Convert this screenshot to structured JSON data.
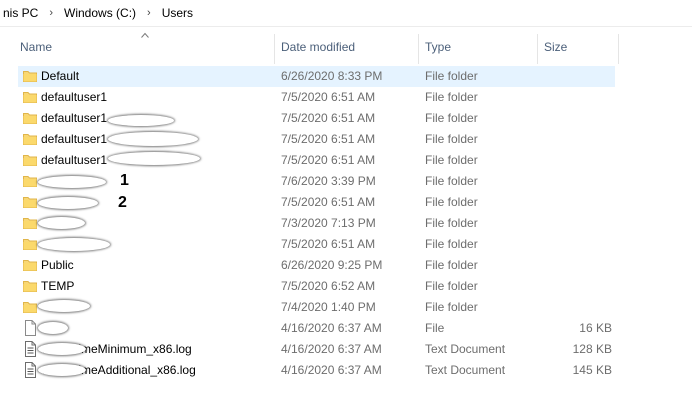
{
  "breadcrumb": [
    "nis PC",
    "Windows (C:)",
    "Users"
  ],
  "columns": {
    "name": "Name",
    "date": "Date modified",
    "type": "Type",
    "size": "Size"
  },
  "rows": [
    {
      "name": "Default",
      "date": "6/26/2020 8:33 PM",
      "type": "File folder",
      "size": "",
      "icon": "folder-icon"
    },
    {
      "name": "defaultuser1",
      "date": "7/5/2020 6:51 AM",
      "type": "File folder",
      "size": "",
      "icon": "folder-icon"
    },
    {
      "name": "defaultuser1",
      "date": "7/5/2020 6:51 AM",
      "type": "File folder",
      "size": "",
      "icon": "folder-icon"
    },
    {
      "name": "defaultuser1",
      "date": "7/5/2020 6:51 AM",
      "type": "File folder",
      "size": "",
      "icon": "folder-icon"
    },
    {
      "name": "defaultuser1",
      "date": "7/5/2020 6:51 AM",
      "type": "File folder",
      "size": "",
      "icon": "folder-icon"
    },
    {
      "name": "",
      "date": "7/6/2020 3:39 PM",
      "type": "File folder",
      "size": "",
      "icon": "folder-icon"
    },
    {
      "name": "",
      "date": "7/5/2020 6:51 AM",
      "type": "File folder",
      "size": "",
      "icon": "folder-icon"
    },
    {
      "name": "",
      "date": "7/3/2020 7:13 PM",
      "type": "File folder",
      "size": "",
      "icon": "folder-icon"
    },
    {
      "name": "",
      "date": "7/5/2020 6:51 AM",
      "type": "File folder",
      "size": "",
      "icon": "folder-icon"
    },
    {
      "name": "Public",
      "date": "6/26/2020 9:25 PM",
      "type": "File folder",
      "size": "",
      "icon": "folder-icon"
    },
    {
      "name": "TEMP",
      "date": "7/5/2020 6:52 AM",
      "type": "File folder",
      "size": "",
      "icon": "folder-icon"
    },
    {
      "name": "",
      "date": "7/4/2020 1:40 PM",
      "type": "File folder",
      "size": "",
      "icon": "folder-icon"
    },
    {
      "name": "",
      "date": "4/16/2020 6:37 AM",
      "type": "File",
      "size": "16 KB",
      "icon": "file-icon"
    },
    {
      "name": "vcRuntimeMinimum_x86.log",
      "date": "4/16/2020 6:37 AM",
      "type": "Text Document",
      "size": "128 KB",
      "icon": "text-file-icon"
    },
    {
      "name": "vcRuntimeAdditional_x86.log",
      "date": "4/16/2020 6:37 AM",
      "type": "Text Document",
      "size": "145 KB",
      "icon": "text-file-icon"
    }
  ],
  "annotations": [
    "1",
    "2"
  ],
  "colors": {
    "selection": "#e5f3ff",
    "header_text": "#4c607a",
    "folder": "#f8d775"
  }
}
